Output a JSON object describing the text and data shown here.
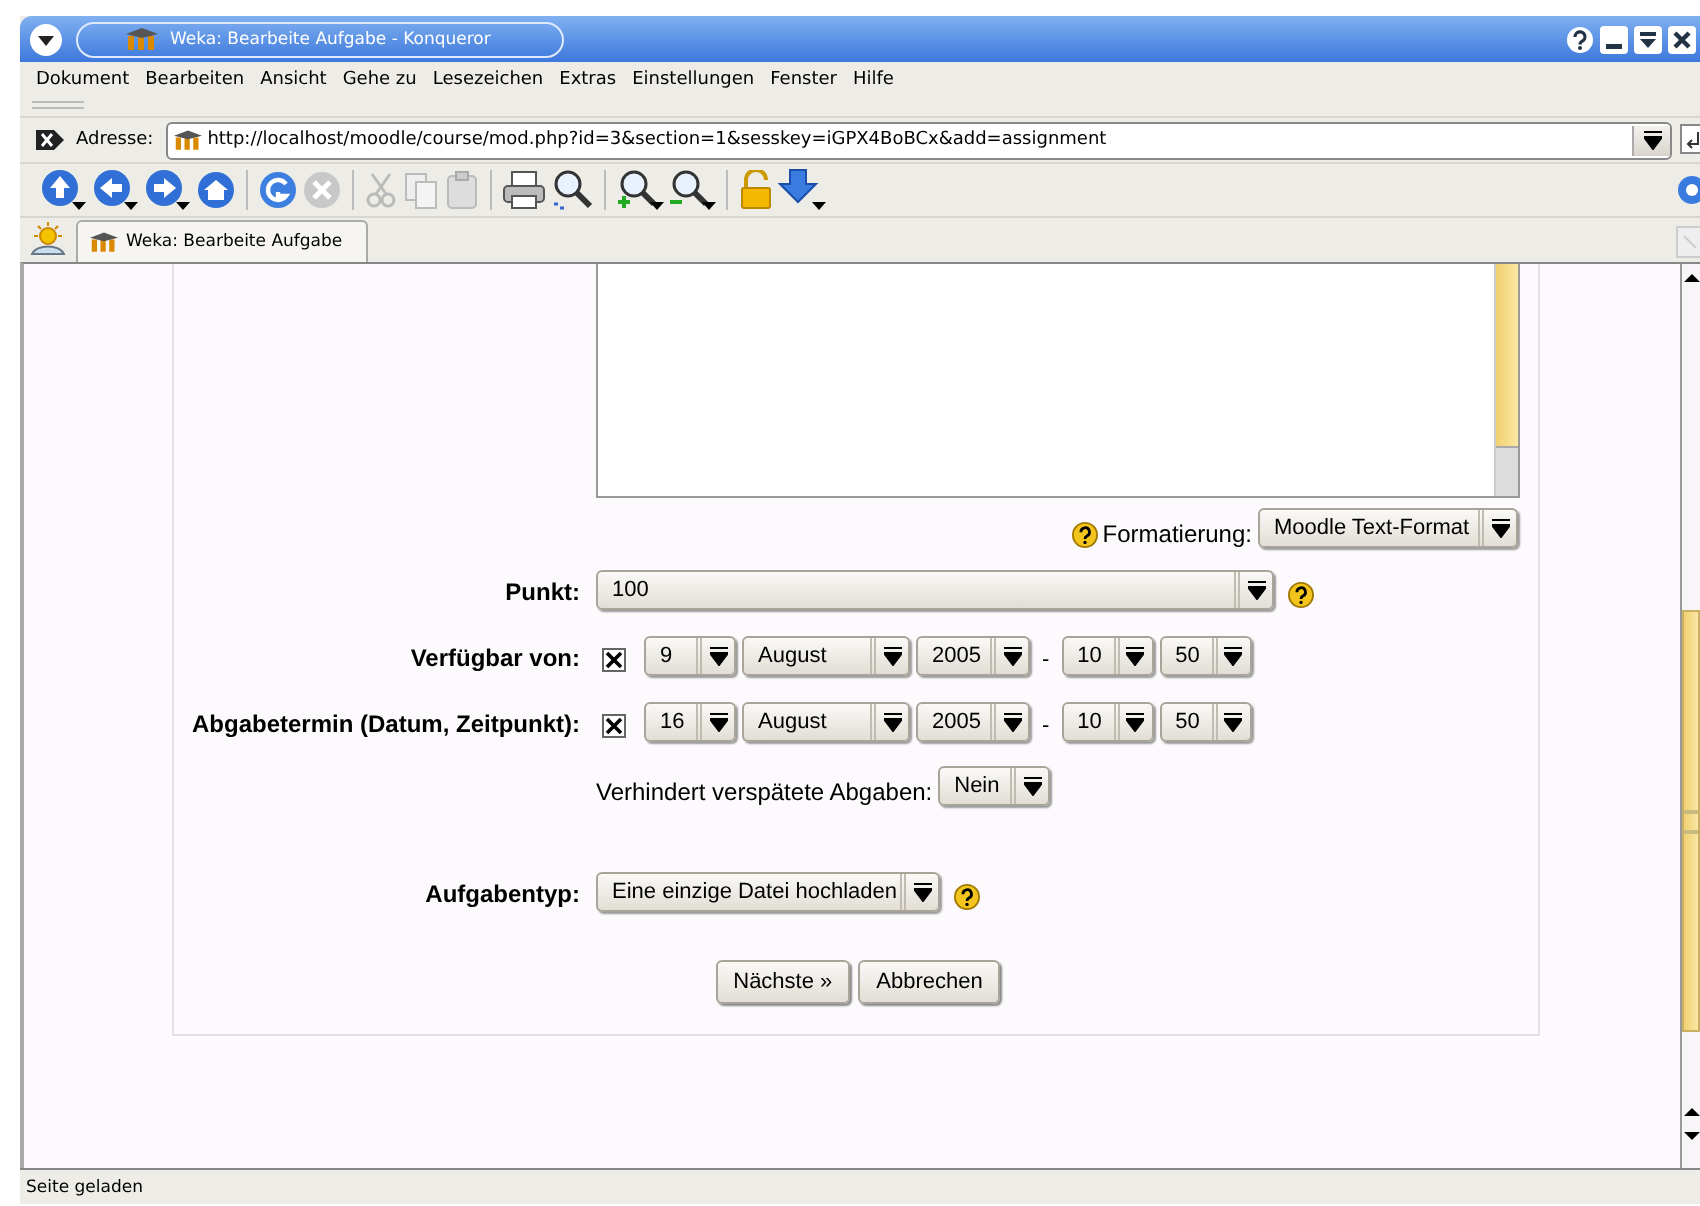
{
  "window": {
    "title": "Weka: Bearbeite Aufgabe - Konqueror"
  },
  "menu": [
    "Dokument",
    "Bearbeiten",
    "Ansicht",
    "Gehe zu",
    "Lesezeichen",
    "Extras",
    "Einstellungen",
    "Fenster",
    "Hilfe"
  ],
  "address": {
    "label": "Adresse:",
    "value": "http://localhost/moodle/course/mod.php?id=3&section=1&sesskey=iGPX4BoBCx&add=assignment"
  },
  "tabs": [
    {
      "label": "Weka: Bearbeite Aufgabe",
      "selected": true
    }
  ],
  "form": {
    "format": {
      "label": "Formatierung:",
      "value": "Moodle Text-Format"
    },
    "fields": [
      {
        "kind": "select",
        "label": "Punkt:",
        "value": "100",
        "help": true
      },
      {
        "kind": "datetime",
        "label": "Verfügbar von:",
        "checked": true,
        "day": "9",
        "month": "August",
        "year": "2005",
        "separator": "-",
        "hour": "10",
        "minute": "50"
      },
      {
        "kind": "datetime",
        "label": "Abgabetermin (Datum, Zeitpunkt):",
        "checked": true,
        "day": "16",
        "month": "August",
        "year": "2005",
        "separator": "-",
        "hour": "10",
        "minute": "50"
      },
      {
        "kind": "inline",
        "text": "Verhindert verspätete Abgaben:",
        "value": "Nein"
      },
      {
        "kind": "short-select",
        "label": "Aufgabentyp:",
        "value": "Eine einzige Datei hochladen",
        "help": true
      }
    ],
    "buttons": [
      "Nächste »",
      "Abbrechen"
    ]
  },
  "status_bar": "Seite geladen"
}
